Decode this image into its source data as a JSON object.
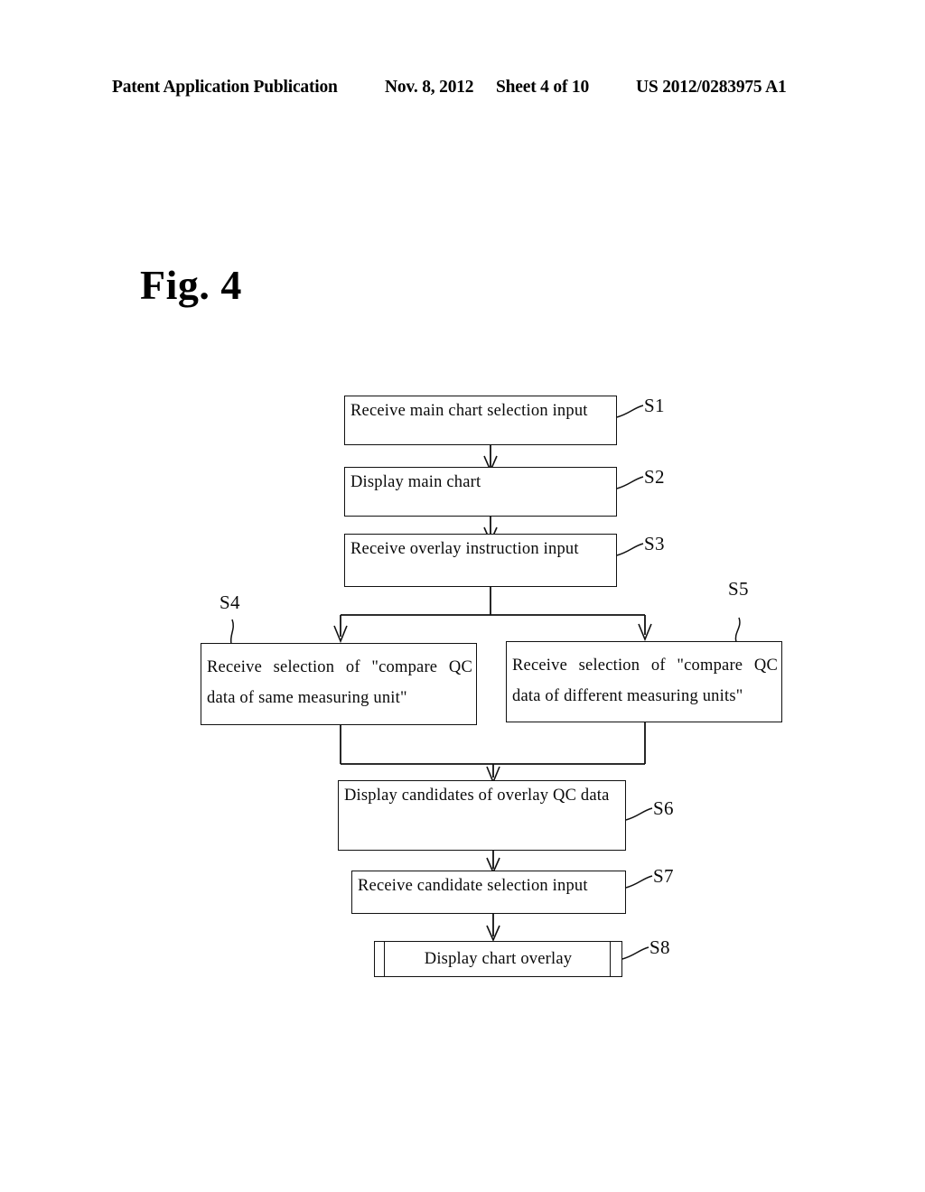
{
  "header": {
    "publication": "Patent Application Publication",
    "date": "Nov. 8, 2012",
    "sheet": "Sheet 4 of 10",
    "patent_number": "US 2012/0283975 A1"
  },
  "figure": {
    "label": "Fig. 4"
  },
  "flowchart": {
    "steps": [
      {
        "id": "S1",
        "ref": "S1",
        "text": "Receive main chart selection input"
      },
      {
        "id": "S2",
        "ref": "S2",
        "text": "Display main chart"
      },
      {
        "id": "S3",
        "ref": "S3",
        "text": "Receive overlay instruction input"
      },
      {
        "id": "S4",
        "ref": "S4",
        "line1": "Receive selection of \"compare QC",
        "line2": "data of same measuring unit\""
      },
      {
        "id": "S5",
        "ref": "S5",
        "line1": "Receive selection of  \"compare QC",
        "line2": "data of different measuring units\""
      },
      {
        "id": "S6",
        "ref": "S6",
        "text": "Display candidates of overlay QC data"
      },
      {
        "id": "S7",
        "ref": "S7",
        "text": "Receive candidate selection input"
      },
      {
        "id": "S8",
        "ref": "S8",
        "text": "Display chart overlay"
      }
    ]
  },
  "colors": {
    "ink": "#111111",
    "paper": "#ffffff"
  }
}
